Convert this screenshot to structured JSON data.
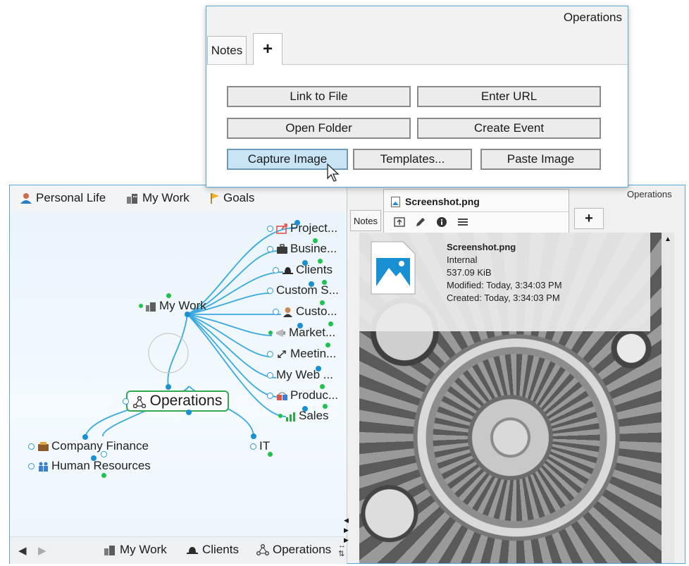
{
  "popup": {
    "title": "Operations",
    "tabs": [
      {
        "label": "Notes"
      },
      {
        "label": "+"
      }
    ],
    "buttons": {
      "link_to_file": "Link to File",
      "enter_url": "Enter URL",
      "open_folder": "Open Folder",
      "create_event": "Create Event",
      "capture_image": "Capture Image",
      "templates": "Templates...",
      "paste_image": "Paste Image"
    }
  },
  "left_pane": {
    "topbar": [
      {
        "label": "Personal Life",
        "icon": "person-icon"
      },
      {
        "label": "My Work",
        "icon": "building-icon"
      },
      {
        "label": "Goals",
        "icon": "flag-icon"
      }
    ],
    "mindmap": {
      "central": "Operations",
      "my_work": "My Work",
      "branches": [
        "Project...",
        "Busine...",
        "Clients",
        "Custom S...",
        "Custo...",
        "Market...",
        "Meetin...",
        "My Web ...",
        "Produc...",
        "Sales"
      ],
      "company_finance": "Company Finance",
      "human_resources": "Human Resources",
      "it": "IT"
    },
    "bottombar": {
      "back": "◀",
      "forward": "▶",
      "crumbs": [
        {
          "label": "My Work",
          "icon": "building-icon"
        },
        {
          "label": "Clients",
          "icon": "bowler-hat-icon"
        },
        {
          "label": "Operations",
          "icon": "network-icon"
        }
      ]
    }
  },
  "right_pane": {
    "title": "Operations",
    "notes_tab": "Notes",
    "file_tab": "Screenshot.png",
    "plus_tab": "+",
    "file_info": {
      "name": "Screenshot.png",
      "location": "Internal",
      "size": "537.09 KiB",
      "modified": "Modified: Today, 3:34:03 PM",
      "created": "Created: Today, 3:34:03 PM"
    }
  },
  "colors": {
    "accent": "#1a8fd1",
    "node_green": "#1ec24c",
    "central_border": "#33a853",
    "button_active": "#c8e4f5"
  }
}
